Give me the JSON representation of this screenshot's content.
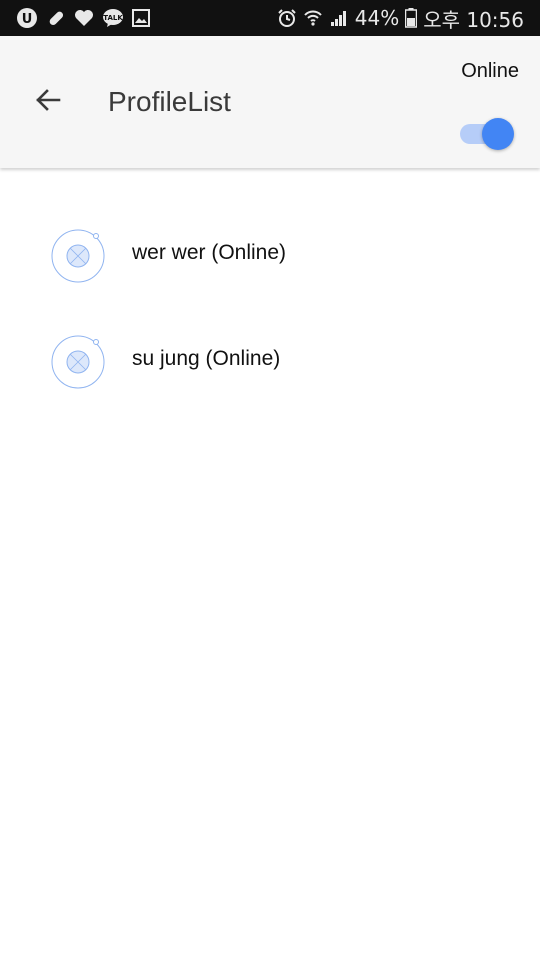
{
  "status_bar": {
    "battery": "44%",
    "time": "오후 10:56",
    "icons": [
      "u-plus-icon",
      "pill-icon",
      "heart-icon",
      "talk-icon",
      "image-icon",
      "alarm-icon",
      "wifi-icon",
      "signal-icon",
      "battery-icon"
    ]
  },
  "app_bar": {
    "title": "ProfileList",
    "back_icon": "arrow-left-icon",
    "online_label": "Online",
    "online_toggle": {
      "on": true
    }
  },
  "profiles": [
    {
      "label": "wer wer (Online)",
      "avatar_icon": "avatar-placeholder-icon"
    },
    {
      "label": "su jung (Online)",
      "avatar_icon": "avatar-placeholder-icon"
    }
  ],
  "colors": {
    "status_bar_bg": "#111111",
    "app_bar_bg": "#f6f6f6",
    "accent": "#4285f4",
    "toggle_track": "#b6cdf8",
    "avatar_stroke": "#90b4f0",
    "avatar_fill": "#dde8fb"
  }
}
